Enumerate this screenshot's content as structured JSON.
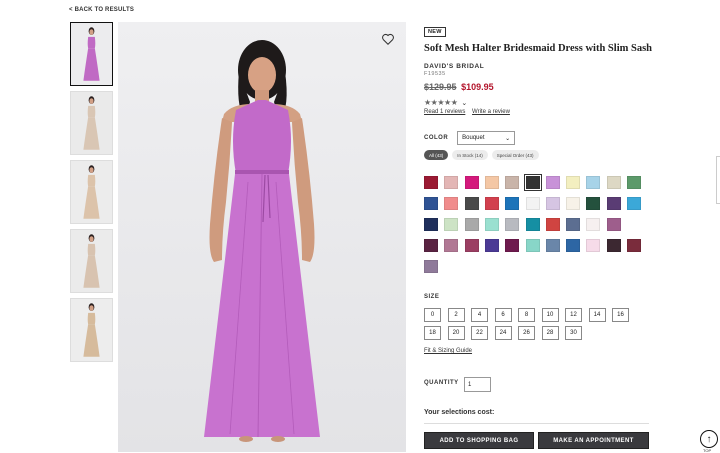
{
  "nav": {
    "back_label": "< BACK TO RESULTS"
  },
  "product": {
    "badge": "NEW",
    "title": "Soft Mesh Halter Bridesmaid Dress with Slim Sash",
    "brand": "DAVID'S BRIDAL",
    "sku": "F19535",
    "price_original": "$129.95",
    "price_sale": "$109.95",
    "rating_stars": "★★★★★",
    "read_reviews_label": "Read 1 reviews",
    "write_review_label": "Write a review"
  },
  "color": {
    "label": "COLOR",
    "selected": "Bouquet",
    "filters": [
      "All (43)",
      "In Stock (14)",
      "Special Order (43)"
    ],
    "selected_swatch_index": 5,
    "swatches": [
      [
        "#9b1a33",
        "#e3b6b5",
        "#d4197c",
        "#f4c7a5",
        "#c9b4a9",
        "#333333",
        "#c892d8",
        "#f3efc0",
        "#a7d3e8",
        "#ddd8c4",
        "#5c9a6a"
      ],
      [
        "#2f5394",
        "#f08c8c",
        "#4a4a4a",
        "#d2404e",
        "#1d74b9",
        "#f3f3f3",
        "#d6c5e3",
        "#f7f2e8",
        "#24513d",
        "#5a3c74",
        "#3ba8d8"
      ],
      [
        "#1f2f5c",
        "#cde3c5",
        "#a9a9a9",
        "#9ae0d0",
        "#b8bac0",
        "#158fa3",
        "#d04441",
        "#5c6e91",
        "#f6f0f0",
        "#9e5e8c",
        ""
      ],
      [
        "#5a2342",
        "#b17894",
        "#9b3e62",
        "#4b3a95",
        "#6e1a4e",
        "#88d6c8",
        "#6a86a9",
        "#2d66a4",
        "#f6dbe9",
        "#3c2831",
        "#7a2c3c"
      ],
      [
        "#8f7a9a",
        "",
        "",
        "",
        "",
        "",
        "",
        "",
        "",
        "",
        ""
      ]
    ]
  },
  "size": {
    "label": "SIZE",
    "options": [
      "0",
      "2",
      "4",
      "6",
      "8",
      "10",
      "12",
      "14",
      "16",
      "18",
      "20",
      "22",
      "24",
      "26",
      "28",
      "30"
    ],
    "fit_guide_label": "Fit & Sizing Guide"
  },
  "quantity": {
    "label": "QUANTITY",
    "value": "1"
  },
  "cost_label": "Your selections cost:",
  "buttons": {
    "add_to_bag": "ADD TO SHOPPING BAG",
    "appointment": "MAKE AN APPOINTMENT"
  },
  "scroll_top_label": "TOP",
  "thumbnails": [
    {
      "dress": "#c06ac4",
      "bg": "#ececee"
    },
    {
      "dress": "#d9c6b4",
      "bg": "#eaeaea"
    },
    {
      "dress": "#dcc3aa",
      "bg": "#ececec"
    },
    {
      "dress": "#d8c3b0",
      "bg": "#ebebeb"
    },
    {
      "dress": "#d6bb9c",
      "bg": "#ededed"
    }
  ]
}
